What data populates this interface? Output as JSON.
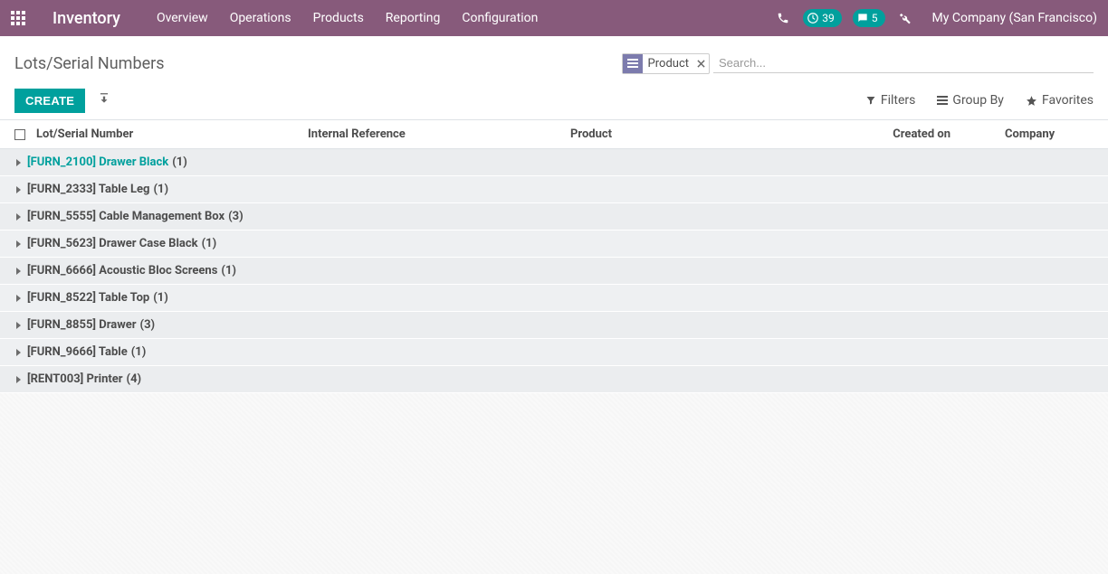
{
  "nav": {
    "brand": "Inventory",
    "items": [
      "Overview",
      "Operations",
      "Products",
      "Reporting",
      "Configuration"
    ],
    "badge_clock": "39",
    "badge_chat": "5",
    "company": "My Company (San Francisco)"
  },
  "page": {
    "title": "Lots/Serial Numbers",
    "create": "CREATE"
  },
  "search": {
    "facet": "Product",
    "placeholder": "Search...",
    "filters": "Filters",
    "groupby": "Group By",
    "favorites": "Favorites"
  },
  "columns": {
    "lot": "Lot/Serial Number",
    "ref": "Internal Reference",
    "product": "Product",
    "created": "Created on",
    "company": "Company"
  },
  "groups": [
    {
      "name": "[FURN_2100] Drawer Black",
      "count": "(1)",
      "active": true
    },
    {
      "name": "[FURN_2333] Table Leg",
      "count": "(1)",
      "active": false
    },
    {
      "name": "[FURN_5555] Cable Management Box",
      "count": "(3)",
      "active": false
    },
    {
      "name": "[FURN_5623] Drawer Case Black",
      "count": "(1)",
      "active": false
    },
    {
      "name": "[FURN_6666] Acoustic Bloc Screens",
      "count": "(1)",
      "active": false
    },
    {
      "name": "[FURN_8522] Table Top",
      "count": "(1)",
      "active": false
    },
    {
      "name": "[FURN_8855] Drawer",
      "count": "(3)",
      "active": false
    },
    {
      "name": "[FURN_9666] Table",
      "count": "(1)",
      "active": false
    },
    {
      "name": "[RENT003] Printer",
      "count": "(4)",
      "active": false
    }
  ]
}
